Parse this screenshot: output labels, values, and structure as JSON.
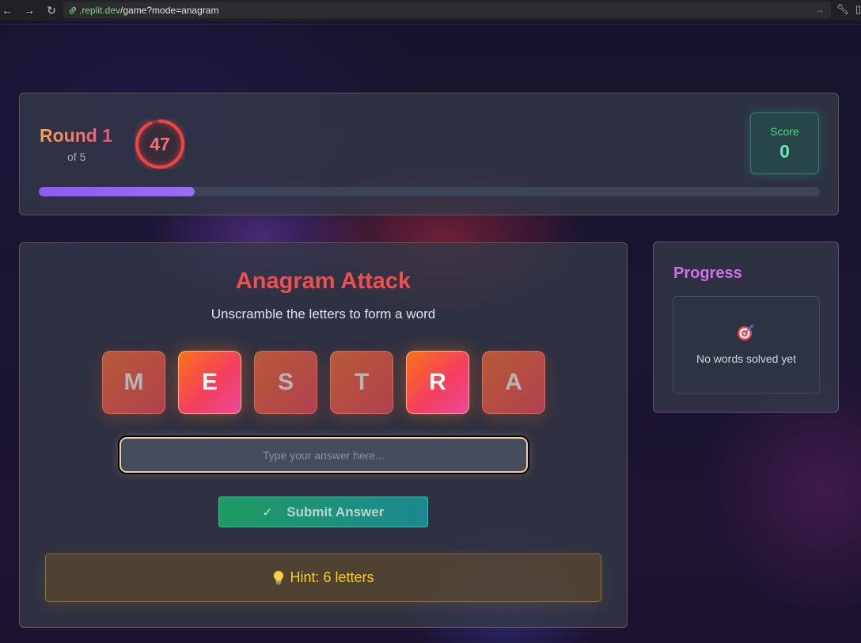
{
  "browser": {
    "url_host": ".replit.dev",
    "url_path": "/game?mode=anagram"
  },
  "round": {
    "label": "Round 1",
    "of_label": "of 5",
    "timer": "47",
    "progress_fraction": 0.2
  },
  "score": {
    "label": "Score",
    "value": "0"
  },
  "game": {
    "title": "Anagram Attack",
    "subtitle": "Unscramble the letters to form a word",
    "tiles": [
      {
        "letter": "M",
        "highlighted": false
      },
      {
        "letter": "E",
        "highlighted": true
      },
      {
        "letter": "S",
        "highlighted": false
      },
      {
        "letter": "T",
        "highlighted": false
      },
      {
        "letter": "R",
        "highlighted": true
      },
      {
        "letter": "A",
        "highlighted": false
      }
    ],
    "input_placeholder": "Type your answer here...",
    "input_value": "",
    "submit_label": "Submit Answer",
    "submit_icon": "check-icon",
    "hint_icon": "lightbulb-icon",
    "hint_text": "Hint: 6 letters"
  },
  "progress": {
    "title": "Progress",
    "empty_icon": "target-icon",
    "empty_text": "No words solved yet"
  },
  "colors": {
    "accent_orange": "#f97316",
    "accent_red": "#ef4f4f",
    "accent_purple": "#8b5cf6",
    "score_green": "#4ade80",
    "hint_yellow": "#facc15"
  }
}
